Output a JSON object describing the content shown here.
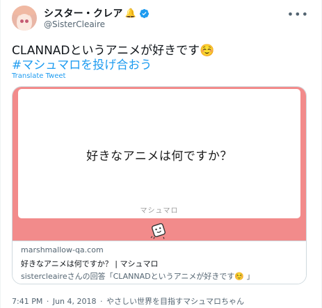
{
  "author": {
    "display_name": "シスター・クレア",
    "bell_emoji": "🔔",
    "handle": "@SisterCleaire",
    "verified": true
  },
  "tweet": {
    "line1": "CLANNADというアニメが好きです☺️",
    "line2": "#マシュマロを投げ合おう",
    "translate_label": "Translate Tweet"
  },
  "card": {
    "question": "好きなアニメは何ですか？",
    "brand": "マシュマロ",
    "domain": "marshmallow-qa.com",
    "title": "好きなアニメは何ですか？ | マシュマロ",
    "description": "sistercleaireさんの回答「CLANNADというアニメが好きです☺️ 」",
    "accent_color": "#f28b8b"
  },
  "footer": {
    "time": "7:41 PM",
    "date": "Jun 4, 2018",
    "source": "やさしい世界を目指すマシュマロちゃん",
    "separator": "·"
  },
  "icons": {
    "more": "more-icon",
    "verified": "verified-icon",
    "mascot": "marshmallow-mascot-icon"
  }
}
